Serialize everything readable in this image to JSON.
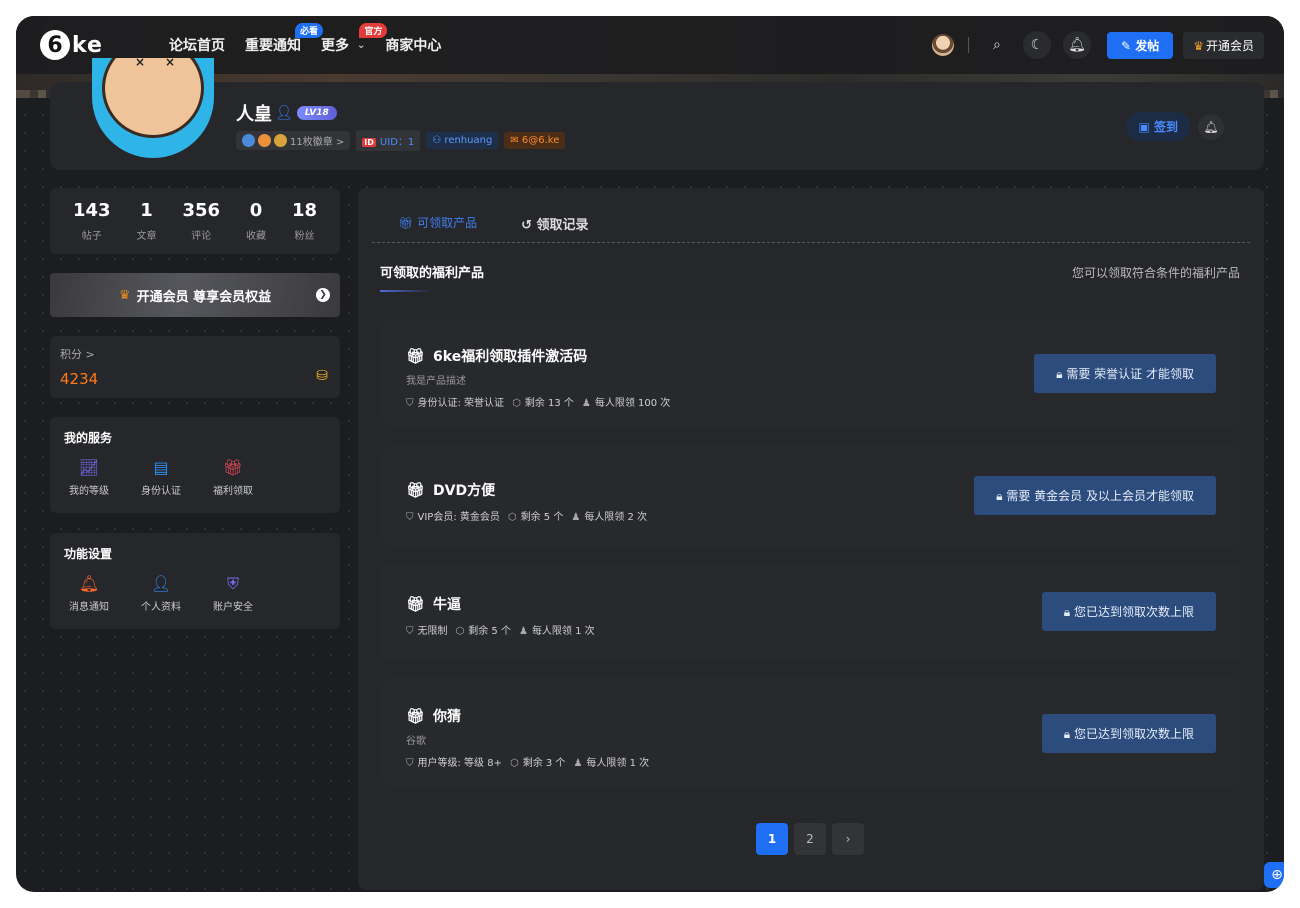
{
  "nav": {
    "logo": "ke",
    "links": [
      {
        "label": "论坛首页",
        "badge": ""
      },
      {
        "label": "重要通知",
        "badge": "必看"
      },
      {
        "label": "更多",
        "badge": "官方"
      },
      {
        "label": "商家中心",
        "badge": ""
      }
    ],
    "post_label": "发帖",
    "vip_label": "开通会员"
  },
  "profile": {
    "name": "人皇",
    "level": "LV18",
    "badges_label": "11枚徽章 >",
    "uid": "UID：1",
    "username": "renhuang",
    "email": "6@6.ke",
    "checkin_label": "签到"
  },
  "stats": [
    {
      "value": "143",
      "label": "帖子"
    },
    {
      "value": "1",
      "label": "文章"
    },
    {
      "value": "356",
      "label": "评论"
    },
    {
      "value": "0",
      "label": "收藏"
    },
    {
      "value": "18",
      "label": "粉丝"
    }
  ],
  "vip_banner": "开通会员 尊享会员权益",
  "points": {
    "label": "积分 >",
    "value": "4234"
  },
  "services": {
    "title": "我的服务",
    "items": [
      {
        "label": "我的等级",
        "icon": "chart-icon"
      },
      {
        "label": "身份认证",
        "icon": "id-card-icon"
      },
      {
        "label": "福利领取",
        "icon": "gift-icon"
      }
    ]
  },
  "settings": {
    "title": "功能设置",
    "items": [
      {
        "label": "消息通知",
        "icon": "bell-icon"
      },
      {
        "label": "个人资料",
        "icon": "user-icon"
      },
      {
        "label": "账户安全",
        "icon": "shield-icon"
      }
    ]
  },
  "main": {
    "tabs": [
      "可领取产品",
      "领取记录"
    ],
    "section_title": "可领取的福利产品",
    "section_sub": "您可以领取符合条件的福利产品",
    "products": [
      {
        "name": "6ke福利领取插件激活码",
        "desc": "我是产品描述",
        "req": "身份认证: 荣誉认证",
        "stock": "剩余 13 个",
        "limit": "每人限领 100 次",
        "button": "需要 荣誉认证 才能领取"
      },
      {
        "name": "DVD方便",
        "desc": "",
        "req": "VIP会员: 黄金会员",
        "stock": "剩余 5 个",
        "limit": "每人限领 2 次",
        "button": "需要 黄金会员 及以上会员才能领取"
      },
      {
        "name": "牛逼",
        "desc": "",
        "req": "无限制",
        "stock": "剩余 5 个",
        "limit": "每人限领 1 次",
        "button": "您已达到领取次数上限"
      },
      {
        "name": "你猜",
        "desc": "谷歌",
        "req": "用户等级: 等级 8+",
        "stock": "剩余 3 个",
        "limit": "每人限领 1 次",
        "button": "您已达到领取次数上限"
      }
    ],
    "pages": [
      "1",
      "2",
      "›"
    ]
  }
}
